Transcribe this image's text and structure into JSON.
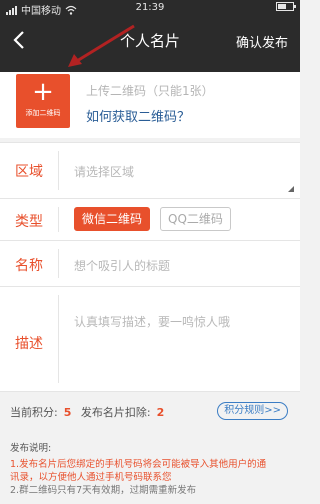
{
  "status": {
    "carrier": "中国移动",
    "time": "21:39",
    "battery_level": 0.6
  },
  "header": {
    "title": "个人名片",
    "action": "确认发布"
  },
  "upload": {
    "button_label": "添加二维码",
    "hint": "上传二维码（只能1张）",
    "help_link": "如何获取二维码？"
  },
  "form": {
    "region": {
      "label": "区域",
      "placeholder": "请选择区域"
    },
    "type": {
      "label": "类型",
      "options": [
        "微信二维码",
        "QQ二维码"
      ],
      "selected": "微信二维码"
    },
    "name": {
      "label": "名称",
      "placeholder": "想个吸引人的标题"
    },
    "desc": {
      "label": "描述",
      "placeholder": "认真填写描述，要一鸣惊人哦"
    }
  },
  "points": {
    "current_label": "当前积分:",
    "current_value": "5",
    "cost_label": "发布名片扣除:",
    "cost_value": "2",
    "rules_button": "积分规则>>"
  },
  "notes": {
    "title": "发布说明:",
    "line1": "1.发布名片后您绑定的手机号码将会可能被导入其他用户的通",
    "line1b": "讯录，以方便他人通过手机号码联系您",
    "line2": "2.群二维码只有7天有效期，过期需重新发布"
  },
  "colors": {
    "accent": "#e8502c",
    "link": "#2a5d96",
    "header_bg": "#2b2b2b"
  }
}
